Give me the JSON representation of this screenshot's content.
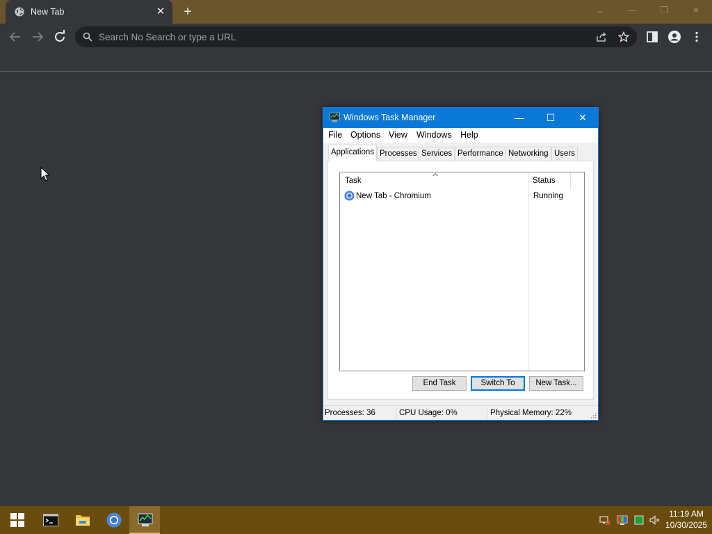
{
  "browser": {
    "tab_title": "New Tab",
    "omnibox_placeholder": "Search No Search or type a URL"
  },
  "task_manager": {
    "window_title": "Windows Task Manager",
    "menu": [
      "File",
      "Options",
      "View",
      "Windows",
      "Help"
    ],
    "tabs": [
      "Applications",
      "Processes",
      "Services",
      "Performance",
      "Networking",
      "Users"
    ],
    "active_tab": "Applications",
    "columns": {
      "task": "Task",
      "status": "Status"
    },
    "rows": [
      {
        "task": "New Tab - Chromium",
        "status": "Running"
      }
    ],
    "buttons": {
      "end_task": "End Task",
      "switch_to": "Switch To",
      "new_task": "New Task..."
    },
    "status_bar": {
      "processes": "Processes: 36",
      "cpu": "CPU Usage: 0%",
      "memory": "Physical Memory: 22%"
    }
  },
  "taskbar": {
    "time": "11:19 AM",
    "date": "10/30/2025"
  },
  "colors": {
    "chrome_frame": "#6b552c",
    "chrome_bg": "#35363a",
    "taskbar": "#6b4c0f",
    "tm_titlebar": "#0a78d7"
  }
}
